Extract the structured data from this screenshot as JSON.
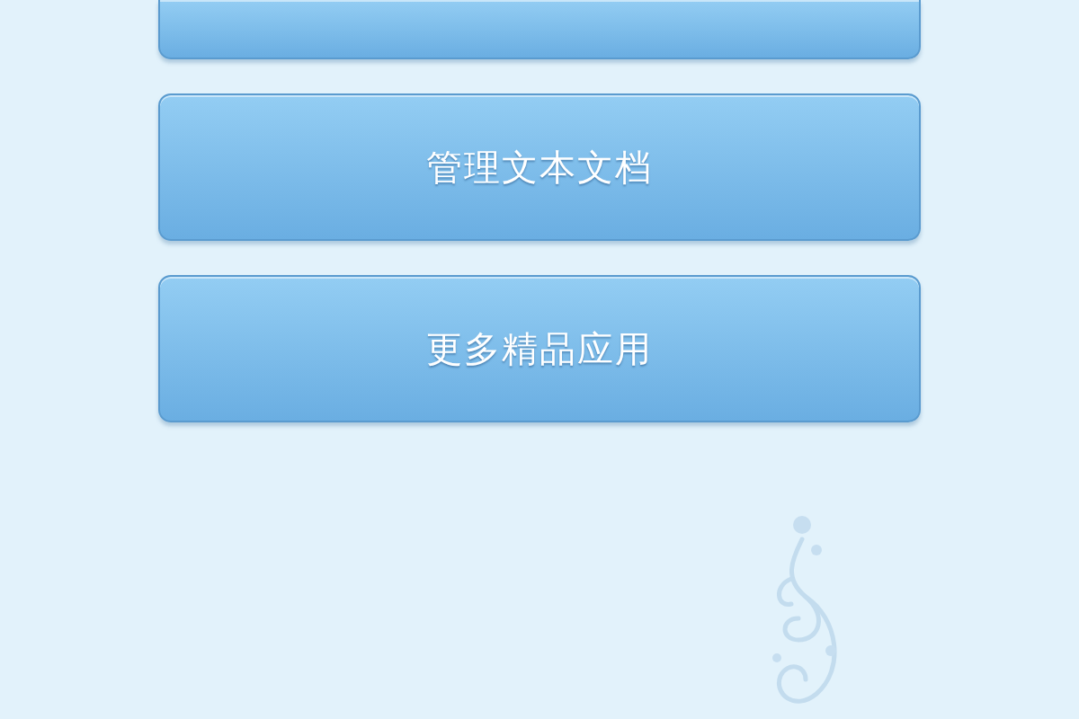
{
  "partial_top_button": true,
  "buttons": [
    {
      "label": "管理文本文档"
    },
    {
      "label": "更多精品应用"
    }
  ]
}
